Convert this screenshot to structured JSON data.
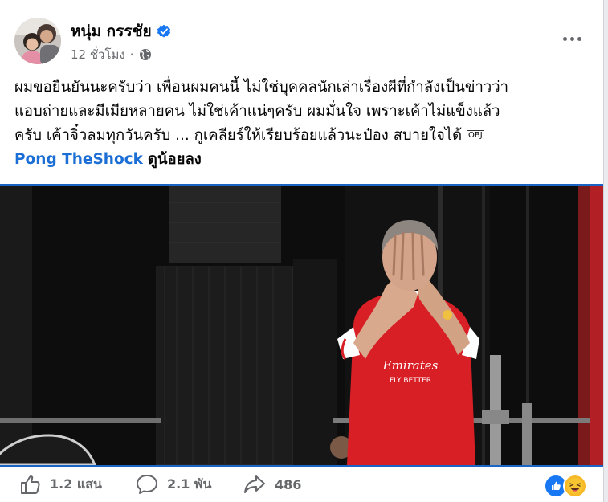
{
  "post": {
    "author": "หนุ่ม กรรชัย",
    "time": "12 ชั่วโมง",
    "separator": "·",
    "lines": [
      "ผมขอยืนยันนะครับว่า เพื่อนผมคนนี้ ไม่ใช่บุคคลนักเล่าเรื่องผีที่กำลังเป็นข่าวว่า",
      "แอบถ่ายและมีเมียหลายคน ไม่ใช่เค้าแน่ๆครับ ผมมั่นใจ เพราะเค้าไม่แข็งแล้ว",
      "ครับ เค้าจิ๋วลมทุกวันครับ  ...  กูเคลียร์ให้เรียบร้อยแล้วนะป๋อง สบายใจได้ "
    ],
    "obj_glyph": "OBJ",
    "mention": "Pong TheShock",
    "see_more": "ดูน้อยลง",
    "shirt_sponsor": "Emirates FLY BETTER"
  },
  "stats": {
    "likes": "1.2 แสน",
    "comments": "2.1 พัน",
    "shares": "486"
  },
  "colors": {
    "mention": "#1b6ed5",
    "verified": "#1877f2",
    "frame": "#1a64c6",
    "shirt": "#d91f26"
  },
  "icons": [
    "verified-badge-icon",
    "globe-icon",
    "more-options-icon",
    "like-icon",
    "comment-icon",
    "share-icon",
    "like-reaction-icon",
    "haha-reaction-icon"
  ]
}
